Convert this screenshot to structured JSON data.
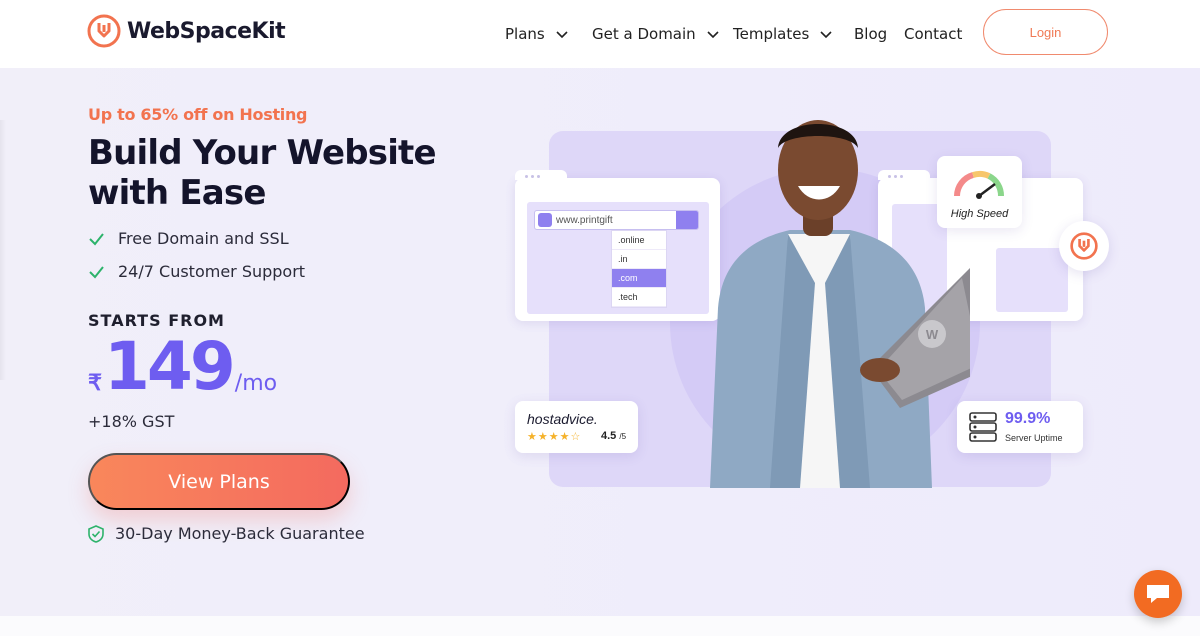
{
  "brand": {
    "name": "WebSpaceKit",
    "accent": "#f2734f",
    "primary": "#6e5df0"
  },
  "nav": {
    "items": [
      {
        "label": "Plans",
        "has_dropdown": true
      },
      {
        "label": "Get a Domain",
        "has_dropdown": true
      },
      {
        "label": "Templates",
        "has_dropdown": true
      },
      {
        "label": "Blog",
        "has_dropdown": false
      },
      {
        "label": "Contact",
        "has_dropdown": false
      }
    ],
    "login_label": "Login"
  },
  "hero": {
    "promo": "Up to 65% off on Hosting",
    "headline": "Build Your Website with Ease",
    "features": [
      "Free Domain and SSL",
      "24/7 Customer Support"
    ],
    "starts_from": "STARTS FROM",
    "currency": "₹",
    "price": "149",
    "period": "/mo",
    "tax": "+18% GST",
    "cta": "View Plans",
    "guarantee": "30-Day Money-Back Guarantee"
  },
  "illustration": {
    "search_value": "www.printgift",
    "domain_options": [
      ".online",
      ".in",
      ".com",
      ".tech"
    ],
    "selected_option": ".com",
    "speed_label": "High Speed",
    "review_site": "hostadvice.",
    "review_score": "4.5",
    "review_scale": "/5",
    "review_rating": 4.5,
    "uptime_value": "99.9%",
    "uptime_label": "Server Uptime"
  }
}
